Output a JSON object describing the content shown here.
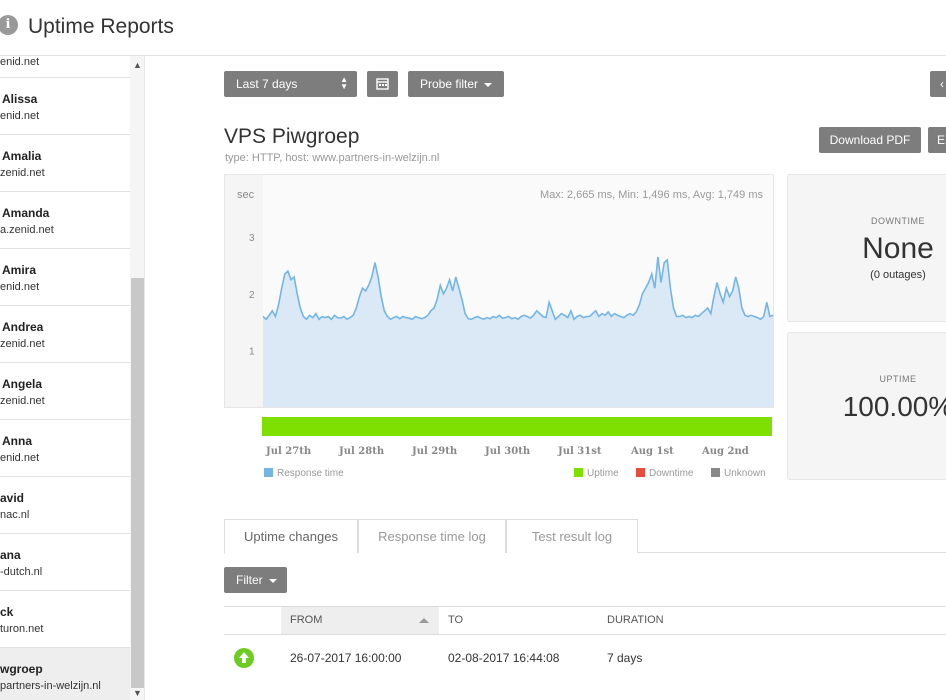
{
  "header": {
    "title": "Uptime Reports",
    "info_icon": "info-icon"
  },
  "sidebar": {
    "items": [
      {
        "name": "",
        "host": "enid.net"
      },
      {
        "name": "Alissa",
        "host": "enid.net"
      },
      {
        "name": "Amalia",
        "host": "zenid.net"
      },
      {
        "name": "Amanda",
        "host": "a.zenid.net"
      },
      {
        "name": "Amira",
        "host": "enid.net"
      },
      {
        "name": "Andrea",
        "host": "zenid.net"
      },
      {
        "name": "Angela",
        "host": "zenid.net"
      },
      {
        "name": "Anna",
        "host": "enid.net"
      },
      {
        "name": "avid",
        "host": "nac.nl"
      },
      {
        "name": "ana",
        "host": "-dutch.nl"
      },
      {
        "name": "ck",
        "host": "turon.net"
      },
      {
        "name": "wgroep",
        "host": "partners-in-welzijn.nl"
      }
    ]
  },
  "toolbar": {
    "range_label": "Last 7 days",
    "calendar_icon": "calendar-icon",
    "probe_filter_label": "Probe filter"
  },
  "monitor": {
    "title": "VPS Piwgroep",
    "subtitle": "type: HTTP, host: www.partners-in-welzijn.nl",
    "download_pdf": "Download PDF",
    "export_short": "E"
  },
  "chart_data": {
    "type": "area",
    "ylabel": "sec",
    "yticks": [
      "1",
      "2",
      "3"
    ],
    "ylim": [
      0,
      4.1
    ],
    "stats_text": "Max: 2,665 ms, Min: 1,496 ms, Avg: 1,749 ms",
    "xticks": [
      "Jul 27th",
      "Jul 28th",
      "Jul 29th",
      "Jul 30th",
      "Jul 31st",
      "Aug 1st",
      "Aug 2nd"
    ],
    "series": [
      {
        "name": "Response time",
        "color": "#74b5e6",
        "values": [
          1.6,
          1.55,
          1.62,
          1.7,
          1.6,
          1.8,
          2.1,
          2.35,
          2.4,
          2.25,
          2.3,
          2.0,
          1.75,
          1.6,
          1.55,
          1.62,
          1.58,
          1.65,
          1.55,
          1.6,
          1.58,
          1.6,
          1.55,
          1.62,
          1.58,
          1.57,
          1.6,
          1.55,
          1.58,
          1.62,
          1.75,
          1.95,
          2.1,
          2.05,
          2.15,
          2.3,
          2.55,
          2.3,
          1.95,
          1.7,
          1.6,
          1.55,
          1.58,
          1.6,
          1.56,
          1.6,
          1.58,
          1.57,
          1.55,
          1.6,
          1.58,
          1.56,
          1.58,
          1.62,
          1.7,
          1.75,
          1.9,
          2.15,
          2.0,
          2.1,
          2.25,
          2.05,
          2.3,
          2.1,
          1.9,
          1.65,
          1.56,
          1.55,
          1.58,
          1.6,
          1.57,
          1.55,
          1.58,
          1.56,
          1.6,
          1.58,
          1.62,
          1.57,
          1.58,
          1.6,
          1.56,
          1.58,
          1.55,
          1.6,
          1.62,
          1.6,
          1.57,
          1.62,
          1.7,
          1.65,
          1.6,
          1.58,
          1.85,
          1.7,
          1.55,
          1.6,
          1.65,
          1.62,
          1.58,
          1.7,
          1.55,
          1.6,
          1.62,
          1.58,
          1.6,
          1.6,
          1.65,
          1.7,
          1.6,
          1.65,
          1.62,
          1.68,
          1.6,
          1.65,
          1.62,
          1.6,
          1.58,
          1.62,
          1.65,
          1.62,
          1.68,
          1.8,
          2.0,
          2.1,
          2.2,
          2.35,
          2.1,
          2.65,
          2.2,
          2.55,
          2.6,
          2.1,
          1.75,
          1.6,
          1.6,
          1.62,
          1.58,
          1.6,
          1.58,
          1.62,
          1.6,
          1.65,
          1.7,
          1.75,
          1.65,
          1.95,
          2.2,
          2.0,
          1.85,
          2.1,
          1.95,
          2.05,
          2.3,
          2.1,
          1.75,
          1.62,
          1.6,
          1.62,
          1.6,
          1.58,
          1.55,
          1.6,
          1.85,
          1.6,
          1.62
        ]
      }
    ],
    "availability": {
      "uptime_percent": 100
    },
    "legend": {
      "response_time": "Response time",
      "uptime": "Uptime",
      "downtime": "Downtime",
      "unknown": "Unknown"
    },
    "colors": {
      "uptime": "#7ee000",
      "downtime": "#e84c3d",
      "unknown": "#888888",
      "response": "#74b5e6"
    }
  },
  "stats": {
    "downtime_label": "DOWNTIME",
    "downtime_value": "None",
    "downtime_sub": "(0 outages)",
    "uptime_label": "UPTIME",
    "uptime_value": "100.00%"
  },
  "tabs": [
    "Uptime changes",
    "Response time log",
    "Test result log"
  ],
  "filter_label": "Filter",
  "table": {
    "headers": {
      "from": "FROM",
      "to": "TO",
      "duration": "DURATION"
    },
    "rows": [
      {
        "status_icon": "arrow-up-icon",
        "from": "26-07-2017 16:00:00",
        "to": "02-08-2017 16:44:08",
        "duration": "7 days"
      }
    ]
  }
}
